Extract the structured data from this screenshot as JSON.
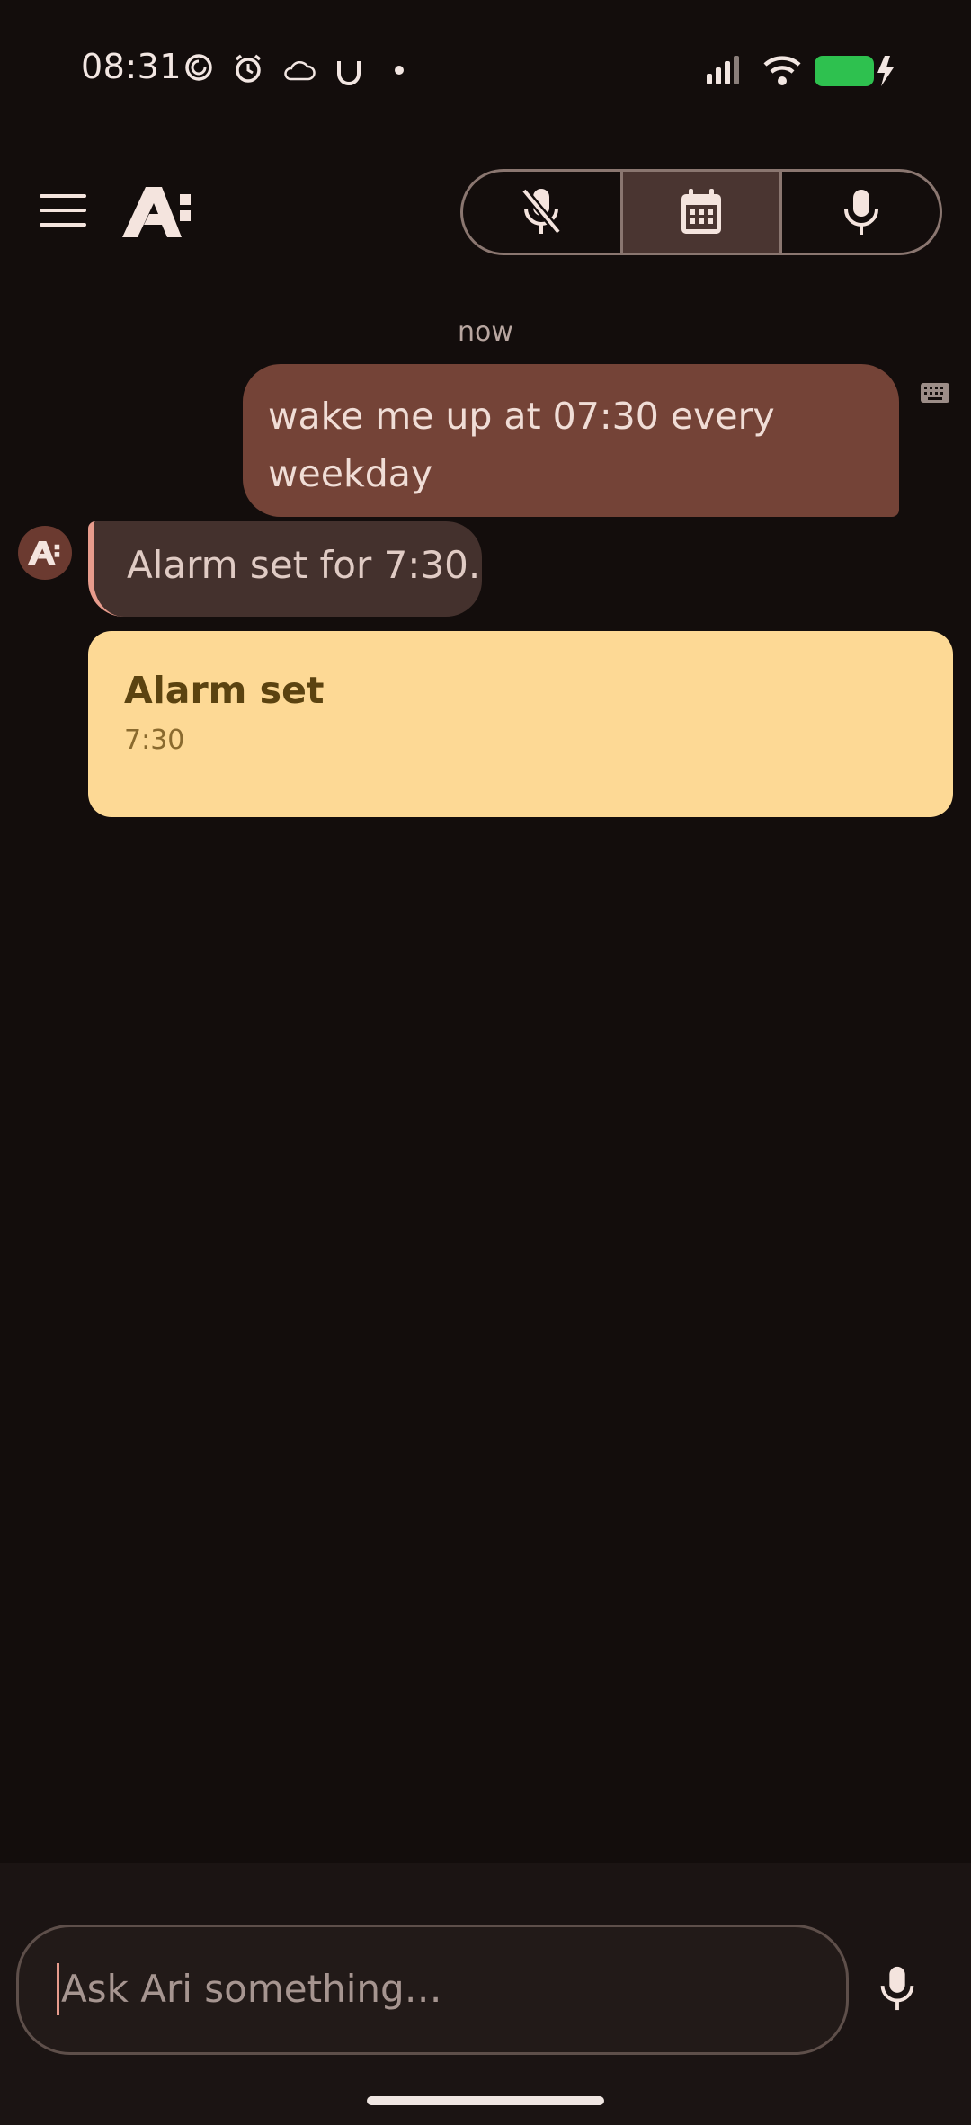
{
  "status_bar": {
    "time": "08:31",
    "icons": [
      "moon-sync-icon",
      "alarm-clock-icon",
      "cloud-icon",
      "u-icon",
      "dot-icon",
      "signal-icon",
      "wifi-icon",
      "battery-charging-icon"
    ],
    "battery_color": "#2ec14f"
  },
  "app_bar": {
    "menu_icon": "hamburger-menu-icon",
    "logo": "ari-logo",
    "mode_buttons": [
      {
        "icon": "microphone-off-icon",
        "active": false
      },
      {
        "icon": "calendar-icon",
        "active": true
      },
      {
        "icon": "microphone-icon",
        "active": false
      }
    ]
  },
  "conversation": {
    "timestamp": "now",
    "user_message": "wake me up at 07:30 every weekday",
    "user_message_source_icon": "keyboard-icon",
    "assistant_message": "Alarm set for 7:30.",
    "card": {
      "title": "Alarm set",
      "subtitle": "7:30",
      "color": "#fdd995"
    }
  },
  "composer": {
    "placeholder": "Ask Ari something…",
    "mic_icon": "microphone-icon"
  },
  "colors": {
    "background": "#130d0c",
    "user_bubble": "#744337",
    "assistant_bubble": "#44312d",
    "accent": "#e79b8c"
  }
}
